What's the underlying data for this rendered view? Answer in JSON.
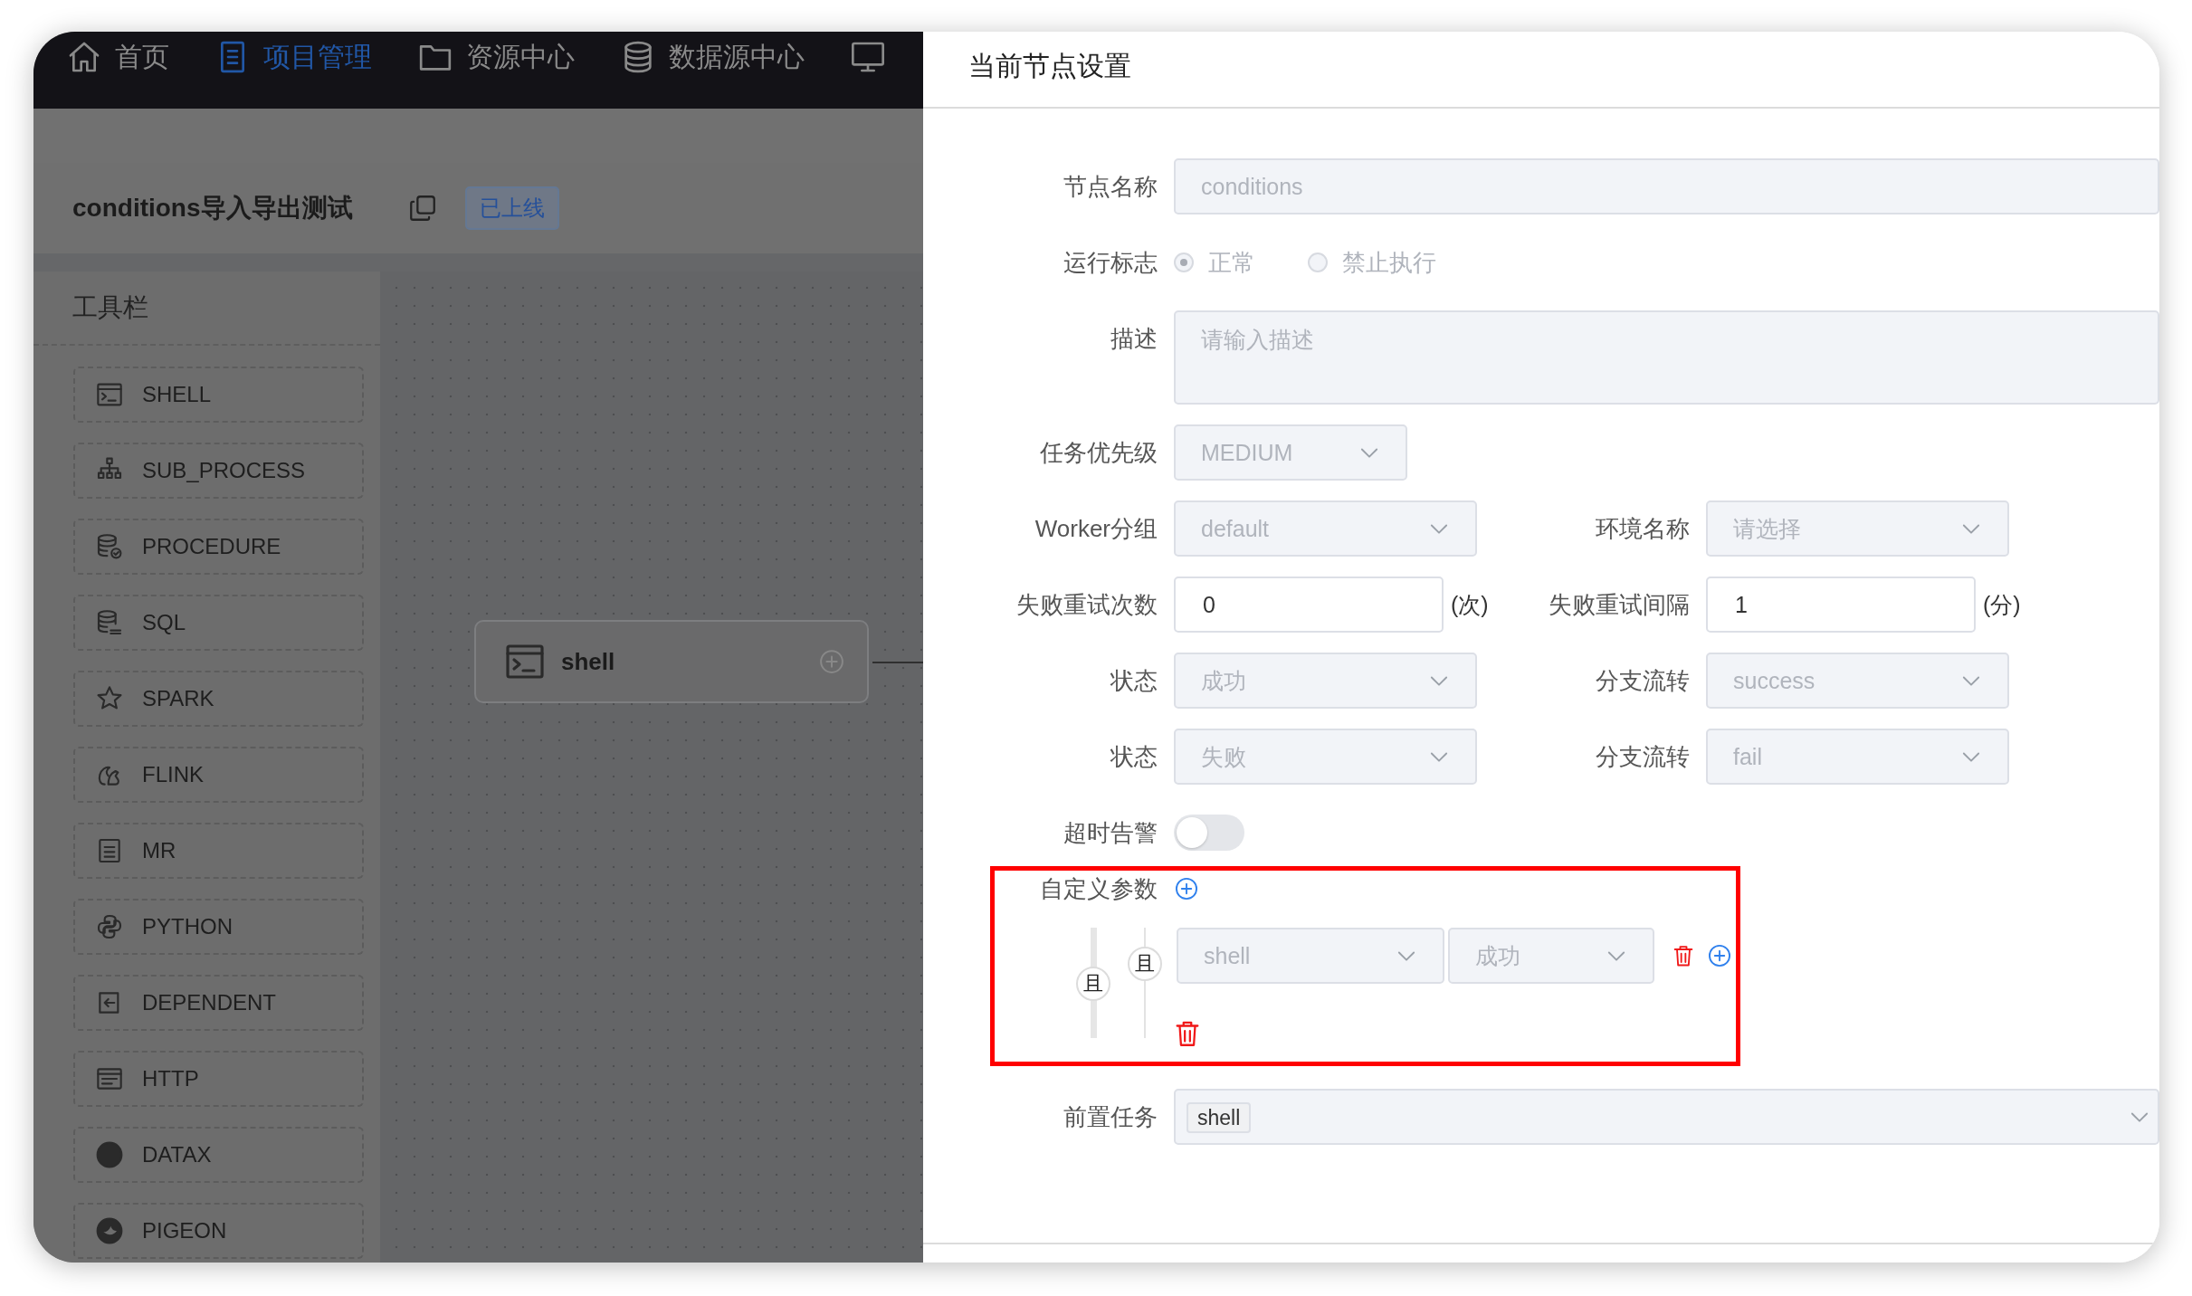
{
  "nav": {
    "items": [
      {
        "label": "首页",
        "selected": false
      },
      {
        "label": "项目管理",
        "selected": true
      },
      {
        "label": "资源中心",
        "selected": false
      },
      {
        "label": "数据源中心",
        "selected": false
      }
    ]
  },
  "workflow": {
    "title": "conditions导入导出测试",
    "status": "已上线"
  },
  "toolbar": {
    "title": "工具栏",
    "items": [
      "SHELL",
      "SUB_PROCESS",
      "PROCEDURE",
      "SQL",
      "SPARK",
      "FLINK",
      "MR",
      "PYTHON",
      "DEPENDENT",
      "HTTP",
      "DATAX",
      "PIGEON"
    ]
  },
  "canvas": {
    "nodes": [
      {
        "label": "shell"
      }
    ]
  },
  "drawer": {
    "title": "当前节点设置",
    "rows": [
      {
        "kind": "input",
        "label": "节点名称",
        "value": "conditions",
        "disabled": true
      },
      {
        "kind": "radio",
        "label": "运行标志",
        "disabled": true,
        "options": [
          {
            "label": "正常",
            "selected": true
          },
          {
            "label": "禁止执行",
            "selected": false
          }
        ]
      },
      {
        "kind": "textarea",
        "label": "描述",
        "placeholder": "请输入描述",
        "disabled": true
      },
      {
        "kind": "select",
        "label": "任务优先级",
        "value": "MEDIUM",
        "disabled": true
      },
      {
        "kind": "pair",
        "items": [
          {
            "kind": "select",
            "label": "Worker分组",
            "value": "default",
            "disabled": true
          },
          {
            "kind": "select",
            "label": "环境名称",
            "placeholder": "请选择",
            "disabled": true
          }
        ]
      },
      {
        "kind": "pair",
        "items": [
          {
            "kind": "number",
            "label": "失败重试次数",
            "value": "0",
            "unit": "(次)",
            "disabled": false
          },
          {
            "kind": "number",
            "label": "失败重试间隔",
            "value": "1",
            "unit": "(分)",
            "disabled": false
          }
        ]
      },
      {
        "kind": "pair",
        "items": [
          {
            "kind": "select",
            "label": "状态",
            "value": "成功",
            "disabled": true
          },
          {
            "kind": "select",
            "label": "分支流转",
            "value": "success",
            "disabled": true
          }
        ]
      },
      {
        "kind": "pair",
        "items": [
          {
            "kind": "select",
            "label": "状态",
            "value": "失败",
            "disabled": true
          },
          {
            "kind": "select",
            "label": "分支流转",
            "value": "fail",
            "disabled": true
          }
        ]
      },
      {
        "kind": "switch",
        "label": "超时告警",
        "on": false
      },
      {
        "kind": "conditions",
        "label": "自定义参数",
        "highlighted": true,
        "relation": "且",
        "groups": [
          {
            "relation": "且",
            "items": [
              {
                "task": "shell",
                "status": "成功",
                "disabled": true
              }
            ]
          }
        ]
      },
      {
        "kind": "tags",
        "label": "前置任务",
        "tags": [
          "shell"
        ]
      }
    ]
  }
}
